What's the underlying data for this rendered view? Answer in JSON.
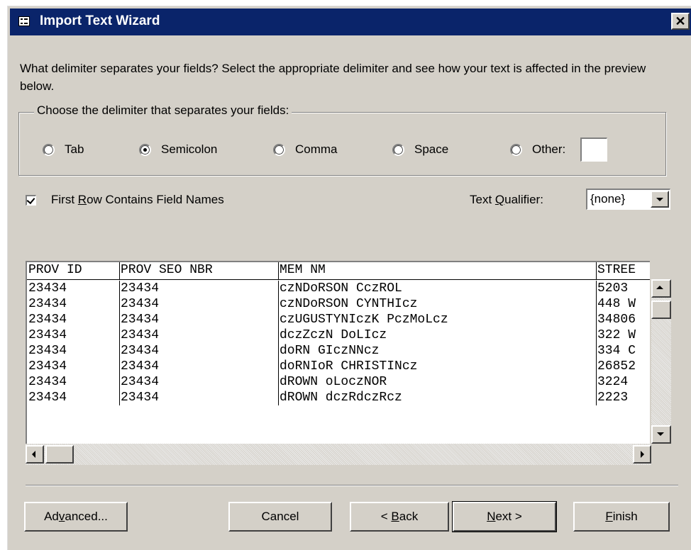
{
  "window": {
    "title": "Import Text Wizard",
    "close_glyph": "✕",
    "icon": "form-window-icon"
  },
  "description": "What delimiter separates your fields?  Select the appropriate delimiter and see how your text is affected in the preview below.",
  "delimiter_group": {
    "legend": "Choose the delimiter that separates your fields:",
    "options": [
      {
        "label": "Tab",
        "selected": false
      },
      {
        "label": "Semicolon",
        "selected": true
      },
      {
        "label": "Comma",
        "selected": false
      },
      {
        "label": "Space",
        "selected": false
      },
      {
        "label": "Other:",
        "selected": false
      }
    ],
    "other_value": ""
  },
  "first_row": {
    "label_pre": "First ",
    "label_u": "R",
    "label_post": "ow Contains Field Names",
    "checked": true
  },
  "text_qualifier": {
    "label_pre": "Text ",
    "label_u": "Q",
    "label_post": "ualifier:",
    "value": "{none}"
  },
  "preview": {
    "columns": [
      "PROV ID",
      "PROV SEO NBR",
      "MEM NM",
      "STREE"
    ],
    "rows": [
      [
        "23434",
        "23434",
        "czNDoRSON CczROL",
        "5203"
      ],
      [
        "23434",
        "23434",
        "czNDoRSON CYNTHIcz",
        "448 W"
      ],
      [
        "23434",
        "23434",
        "czUGUSTYNIczK PczMoLcz",
        "34806"
      ],
      [
        "23434",
        "23434",
        "dczZczN DoLIcz",
        "322 W"
      ],
      [
        "23434",
        "23434",
        "doRN GIczNNcz",
        "334 C"
      ],
      [
        "23434",
        "23434",
        "doRNIoR CHRISTINcz",
        "26852"
      ],
      [
        "23434",
        "23434",
        "dROWN oLoczNOR",
        "3224"
      ],
      [
        "23434",
        "23434",
        "dROWN dczRdczRcz",
        "2223"
      ]
    ]
  },
  "buttons": {
    "advanced": {
      "pre": "Ad",
      "u": "v",
      "post": "anced..."
    },
    "cancel": "Cancel",
    "back": {
      "pre": "< ",
      "u": "B",
      "post": "ack"
    },
    "next": {
      "pre": "",
      "u": "N",
      "post": "ext >"
    },
    "finish": {
      "pre": "",
      "u": "F",
      "post": "inish"
    }
  }
}
